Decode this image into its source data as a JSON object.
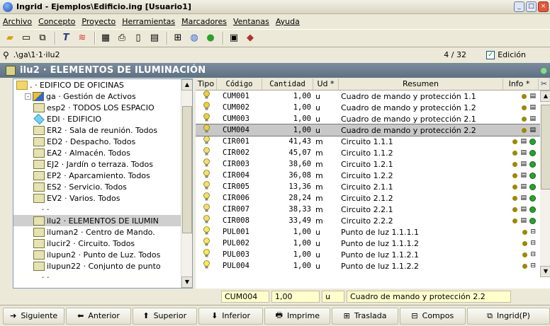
{
  "window": {
    "title": "Ingrid - Ejemplos\\Edificio.ing  [Usuario1]",
    "controls": [
      "_",
      "□",
      "×"
    ]
  },
  "menu": [
    "Archivo",
    "Concepto",
    "Proyecto",
    "Herramientas",
    "Marcadores",
    "Ventanas",
    "Ayuda"
  ],
  "pathbar": {
    "path": ".\\ga\\1·1·ilu2",
    "counter": "4 / 32",
    "edit_label": "Edición",
    "edit_checked": true
  },
  "header": {
    "title": "ilu2 · ELEMENTOS DE ILUMINACIÓN"
  },
  "tree": [
    {
      "label": ". · EDIFICO DE OFICINAS",
      "icon": "folder",
      "indent": 0
    },
    {
      "label": "ga · Gestión de Activos",
      "icon": "mixed",
      "indent": 1,
      "expander": "-"
    },
    {
      "label": "esp2 · TODOS LOS ESPACIO",
      "icon": "bulb-box",
      "indent": 2
    },
    {
      "label": "EDI · EDIFICIO",
      "icon": "diamond",
      "indent": 2
    },
    {
      "label": "ER2 · Sala de reunión. Todos",
      "icon": "bulb-box",
      "indent": 2
    },
    {
      "label": "ED2 · Despacho. Todos",
      "icon": "bulb-box",
      "indent": 2
    },
    {
      "label": "EA2 · Almacén. Todos",
      "icon": "bulb-box",
      "indent": 2
    },
    {
      "label": "EJ2 · Jardín o terraza. Todos",
      "icon": "bulb-box",
      "indent": 2
    },
    {
      "label": "EP2 · Aparcamiento. Todos",
      "icon": "bulb-box",
      "indent": 2
    },
    {
      "label": "ES2 · Servicio. Todos",
      "icon": "bulb-box",
      "indent": 2
    },
    {
      "label": "EV2 · Varios. Todos",
      "icon": "bulb-box",
      "indent": 2
    },
    {
      "label": "· ·",
      "icon": "none",
      "indent": 3
    },
    {
      "label": "ilu2 · ELEMENTOS DE ILUMIN",
      "icon": "bulb-box",
      "indent": 2,
      "selected": true
    },
    {
      "label": "iluman2 · Centro de Mando. ",
      "icon": "bulb-box",
      "indent": 2
    },
    {
      "label": "ilucir2 · Circuito. Todos",
      "icon": "bulb-box",
      "indent": 2
    },
    {
      "label": "ilupun2 · Punto de Luz. Todos",
      "icon": "bulb-box",
      "indent": 2
    },
    {
      "label": "ilupun22 · Conjunto de punto",
      "icon": "bulb-box",
      "indent": 2
    },
    {
      "label": "· ·",
      "icon": "none",
      "indent": 3
    }
  ],
  "grid": {
    "columns": [
      "Tipo",
      "Código",
      "Cantidad",
      "Ud *",
      "Resumen",
      "Info *"
    ],
    "rows": [
      {
        "code": "CUM001",
        "qty": "1,00",
        "ud": "u",
        "resumen": "Cuadro de mando y protección 1.1",
        "kind": "cum"
      },
      {
        "code": "CUM002",
        "qty": "1,00",
        "ud": "u",
        "resumen": "Cuadro de mando y protección 1.2",
        "kind": "cum"
      },
      {
        "code": "CUM003",
        "qty": "1,00",
        "ud": "u",
        "resumen": "Cuadro de mando y protección 2.1",
        "kind": "cum"
      },
      {
        "code": "CUM004",
        "qty": "1,00",
        "ud": "u",
        "resumen": "Cuadro de mando y protección 2.2",
        "kind": "cum",
        "selected": true
      },
      {
        "code": "CIR001",
        "qty": "41,43",
        "ud": "m",
        "resumen": "Circuito 1.1.1",
        "kind": "cir"
      },
      {
        "code": "CIR002",
        "qty": "45,07",
        "ud": "m",
        "resumen": "Circuito 1.1.2",
        "kind": "cir"
      },
      {
        "code": "CIR003",
        "qty": "38,60",
        "ud": "m",
        "resumen": "Circuito 1.2.1",
        "kind": "cir"
      },
      {
        "code": "CIR004",
        "qty": "36,08",
        "ud": "m",
        "resumen": "Circuito 1.2.2",
        "kind": "cir"
      },
      {
        "code": "CIR005",
        "qty": "13,36",
        "ud": "m",
        "resumen": "Circuito 2.1.1",
        "kind": "cir"
      },
      {
        "code": "CIR006",
        "qty": "28,24",
        "ud": "m",
        "resumen": "Circuito 2.1.2",
        "kind": "cir"
      },
      {
        "code": "CIR007",
        "qty": "38,33",
        "ud": "m",
        "resumen": "Circuito 2.2.1",
        "kind": "cir"
      },
      {
        "code": "CIR008",
        "qty": "33,49",
        "ud": "m",
        "resumen": "Circuito 2.2.2",
        "kind": "cir"
      },
      {
        "code": "PUL001",
        "qty": "1,00",
        "ud": "u",
        "resumen": "Punto de luz 1.1.1.1",
        "kind": "pul"
      },
      {
        "code": "PUL002",
        "qty": "1,00",
        "ud": "u",
        "resumen": "Punto de luz 1.1.1.2",
        "kind": "pul"
      },
      {
        "code": "PUL003",
        "qty": "1,00",
        "ud": "u",
        "resumen": "Punto de luz 1.1.2.1",
        "kind": "pul"
      },
      {
        "code": "PUL004",
        "qty": "1,00",
        "ud": "u",
        "resumen": "Punto de luz 1.1.2.2",
        "kind": "pul"
      }
    ]
  },
  "edit_row": {
    "code": "CUM004",
    "qty": "1,00",
    "ud": "u",
    "resumen": "Cuadro de mando y protección 2.2"
  },
  "buttons": [
    {
      "label": "Siguiente",
      "icon": "➔"
    },
    {
      "label": "Anterior",
      "icon": "⬅"
    },
    {
      "label": "Superior",
      "icon": "⬆"
    },
    {
      "label": "Inferior",
      "icon": "⬇"
    },
    {
      "label": "Imprime",
      "icon": "🖶"
    },
    {
      "label": "Traslada",
      "icon": "⊞"
    },
    {
      "label": "Compos",
      "icon": "⊟"
    },
    {
      "label": "Ingrid(P)",
      "icon": "⧉"
    }
  ],
  "colors": {
    "header_bg": "#6a7d8f",
    "selected_row": "#c8c8c8",
    "edit_field": "#ffffcc",
    "status_green": "#29a329"
  }
}
